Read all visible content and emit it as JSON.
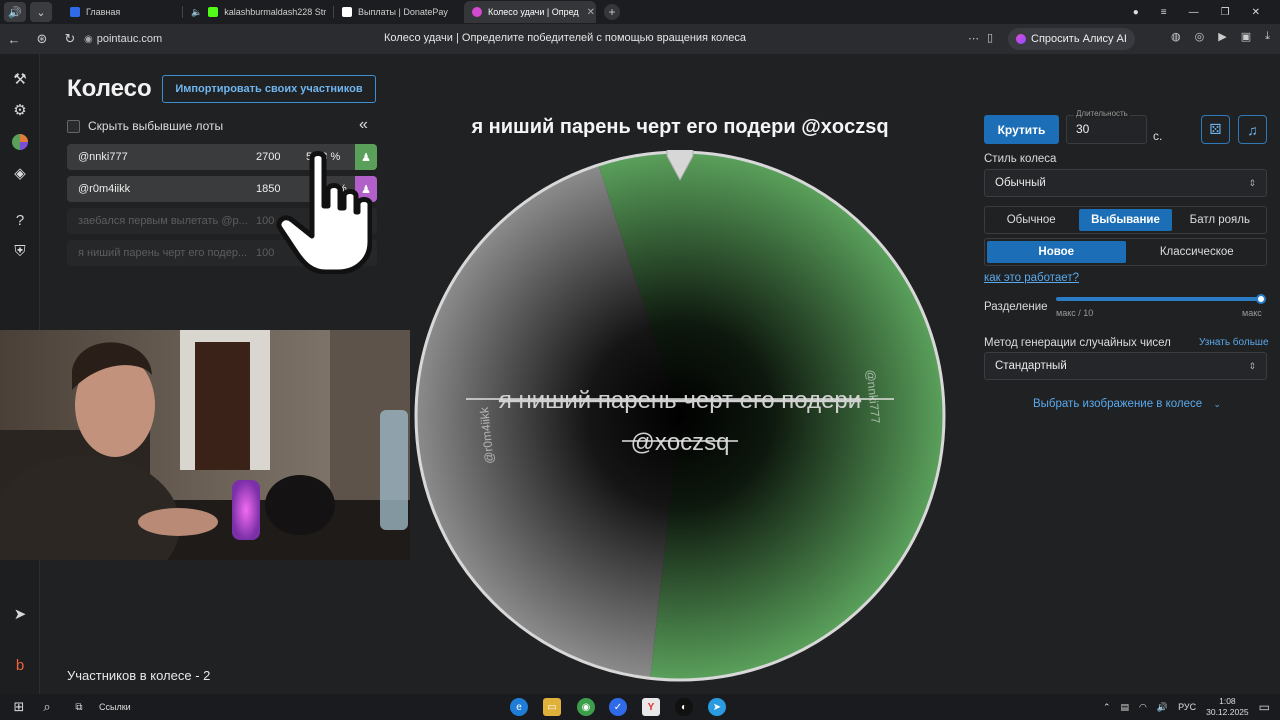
{
  "browser": {
    "tabs": [
      {
        "label": "Главная",
        "fav_color": "#2f6be8"
      },
      {
        "label": "kalashburmaldash228 Str",
        "fav_color": "#53fc18"
      },
      {
        "label": "Выплаты | DonatePay",
        "fav_color": "#ffffff"
      },
      {
        "label": "Колесо удачи | Опред",
        "fav_color": "#d24ad0"
      }
    ],
    "url": "pointauc.com",
    "page_title": "Колесо удачи | Определите победителей с помощью вращения колеса",
    "alice_label": "Спросить Алису AI"
  },
  "left_panel": {
    "title": "Колесо",
    "import_label": "Импортировать своих участников",
    "hide_label": "Скрыть выбывшие лоты",
    "collapse_glyph": "«",
    "lots": [
      {
        "name": "@nnki777",
        "amount": "2700",
        "percent": "56.8 %",
        "color": "#5aa05b",
        "eliminated": false
      },
      {
        "name": "@r0m4iikk",
        "amount": "1850",
        "percent": "%",
        "color": "#b160c9",
        "eliminated": false
      },
      {
        "name": "заебался первым вылетать @p...",
        "amount": "100",
        "percent": "",
        "color": "",
        "eliminated": true
      },
      {
        "name": "я ниший парень черт его подер...",
        "amount": "100",
        "percent": "",
        "color": "",
        "eliminated": true
      }
    ],
    "participants_count": "Участников в колесе - 2"
  },
  "wheel": {
    "title": "я ниший парень черт его подери @xoczsq",
    "center_text_line1": "я ниший парень черт его подери",
    "center_text_line2": "@xoczsq",
    "segments": [
      {
        "label": "@nnki777",
        "color": "#5aa05b",
        "share": 0.568
      },
      {
        "label": "@r0m4iikk",
        "color": "#8b8b8b",
        "share": 0.432
      }
    ]
  },
  "right_panel": {
    "spin_label": "Крутить",
    "duration_label": "Длительность",
    "duration_value": "30",
    "duration_unit": "с.",
    "wheel_style_label": "Стиль колеса",
    "wheel_style_value": "Обычный",
    "mode_options": [
      "Обычное",
      "Выбывание",
      "Батл рояль"
    ],
    "mode_selected": "Выбывание",
    "variant_options": [
      "Новое",
      "Классическое"
    ],
    "variant_selected": "Новое",
    "how_link": "как это работает?",
    "split_label": "Разделение",
    "split_min": "макс / 10",
    "split_max": "макс",
    "split_value_fraction": 1.0,
    "rng_label": "Метод генерации случайных чисел",
    "rng_learn": "Узнать больше",
    "rng_value": "Стандартный",
    "image_link": "Выбрать изображение в колесе"
  },
  "taskbar": {
    "links_label": "Ссылки",
    "lang": "РУС",
    "time": "1:08",
    "date": "30.12.2025"
  }
}
